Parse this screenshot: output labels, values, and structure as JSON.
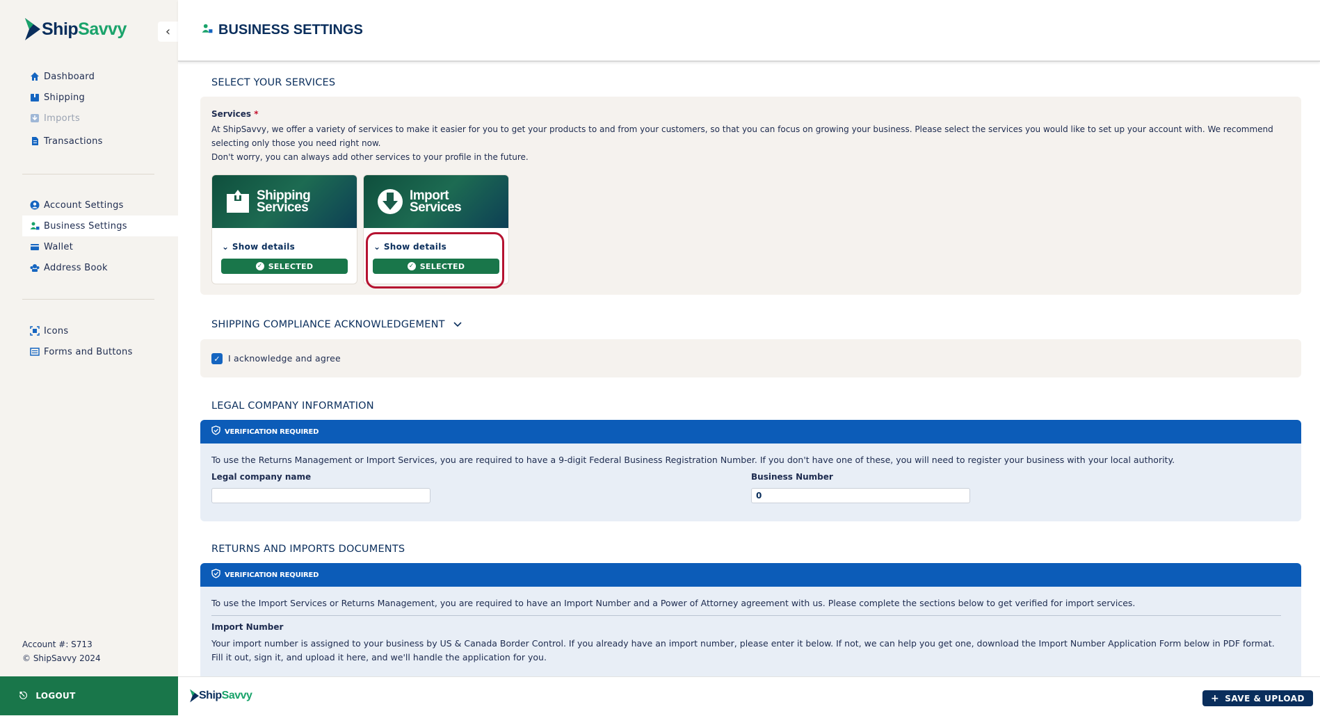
{
  "app": {
    "brand_part1": "Ship",
    "brand_part2": "Savvy",
    "page_title": "BUSINESS SETTINGS"
  },
  "sidebar": {
    "primary": [
      {
        "label": "Dashboard",
        "icon": "home-icon"
      },
      {
        "label": "Shipping",
        "icon": "package-icon"
      },
      {
        "label": "Imports",
        "icon": "import-icon",
        "disabled": true
      },
      {
        "label": "Transactions",
        "icon": "document-icon"
      }
    ],
    "settings": [
      {
        "label": "Account Settings",
        "icon": "user-circle-icon"
      },
      {
        "label": "Business Settings",
        "icon": "business-icon",
        "active": true
      },
      {
        "label": "Wallet",
        "icon": "wallet-icon"
      },
      {
        "label": "Address Book",
        "icon": "address-book-icon"
      }
    ],
    "dev": [
      {
        "label": "Icons",
        "icon": "icons-icon"
      },
      {
        "label": "Forms and Buttons",
        "icon": "forms-icon"
      }
    ],
    "account_number": "Account #: S713",
    "copyright": "© ShipSavvy 2024",
    "logout_label": "LOGOUT"
  },
  "services": {
    "section_title": "SELECT YOUR SERVICES",
    "label": "Services",
    "required_mark": "*",
    "description_1": "At ShipSavvy, we offer a variety of services to make it easier for you to get your products to and from your customers, so that you can focus on growing your business. Please select the services you would like to set up your account with. We recommend selecting only those you need right now.",
    "description_2": "Don't worry, you can always add other services to your profile in the future.",
    "cards": [
      {
        "line1": "Shipping",
        "line2": "Services",
        "show_details": "Show details",
        "status": "SELECTED"
      },
      {
        "line1": "Import",
        "line2": "Services",
        "show_details": "Show details",
        "status": "SELECTED"
      }
    ]
  },
  "compliance": {
    "section_title": "SHIPPING COMPLIANCE ACKNOWLEDGEMENT",
    "checkbox_label": "I acknowledge and agree",
    "checked": true
  },
  "legal": {
    "section_title": "LEGAL COMPANY INFORMATION",
    "banner": "VERIFICATION REQUIRED",
    "notice": "To use the Returns Management or Import Services, you are required to have a 9-digit Federal Business Registration Number. If you don't have one of these, you will need to register your business with your local authority.",
    "company_name_label": "Legal company name",
    "company_name_value": "",
    "business_number_label": "Business Number",
    "business_number_value": "0"
  },
  "documents": {
    "section_title": "RETURNS AND IMPORTS DOCUMENTS",
    "banner": "VERIFICATION REQUIRED",
    "notice": "To use the Import Services or Returns Management, you are required to have an Import Number and a Power of Attorney agreement with us. Please complete the sections below to get verified for import services.",
    "import_number_label": "Import Number",
    "import_number_desc_1": "Your import number is assigned to your business by US & Canada Border Control. If you already have an import number, please enter it below. If not, we can help you get one, download the Import Number Application Form below in PDF format.",
    "import_number_desc_2": "Fill it out, sign it, and upload it here, and we'll handle the application for you."
  },
  "footer": {
    "save_label": "SAVE & UPLOAD"
  },
  "colors": {
    "navy": "#0a2e5c",
    "green": "#19764a",
    "blue_banner": "#0c5cb8",
    "highlight": "#b51230"
  }
}
